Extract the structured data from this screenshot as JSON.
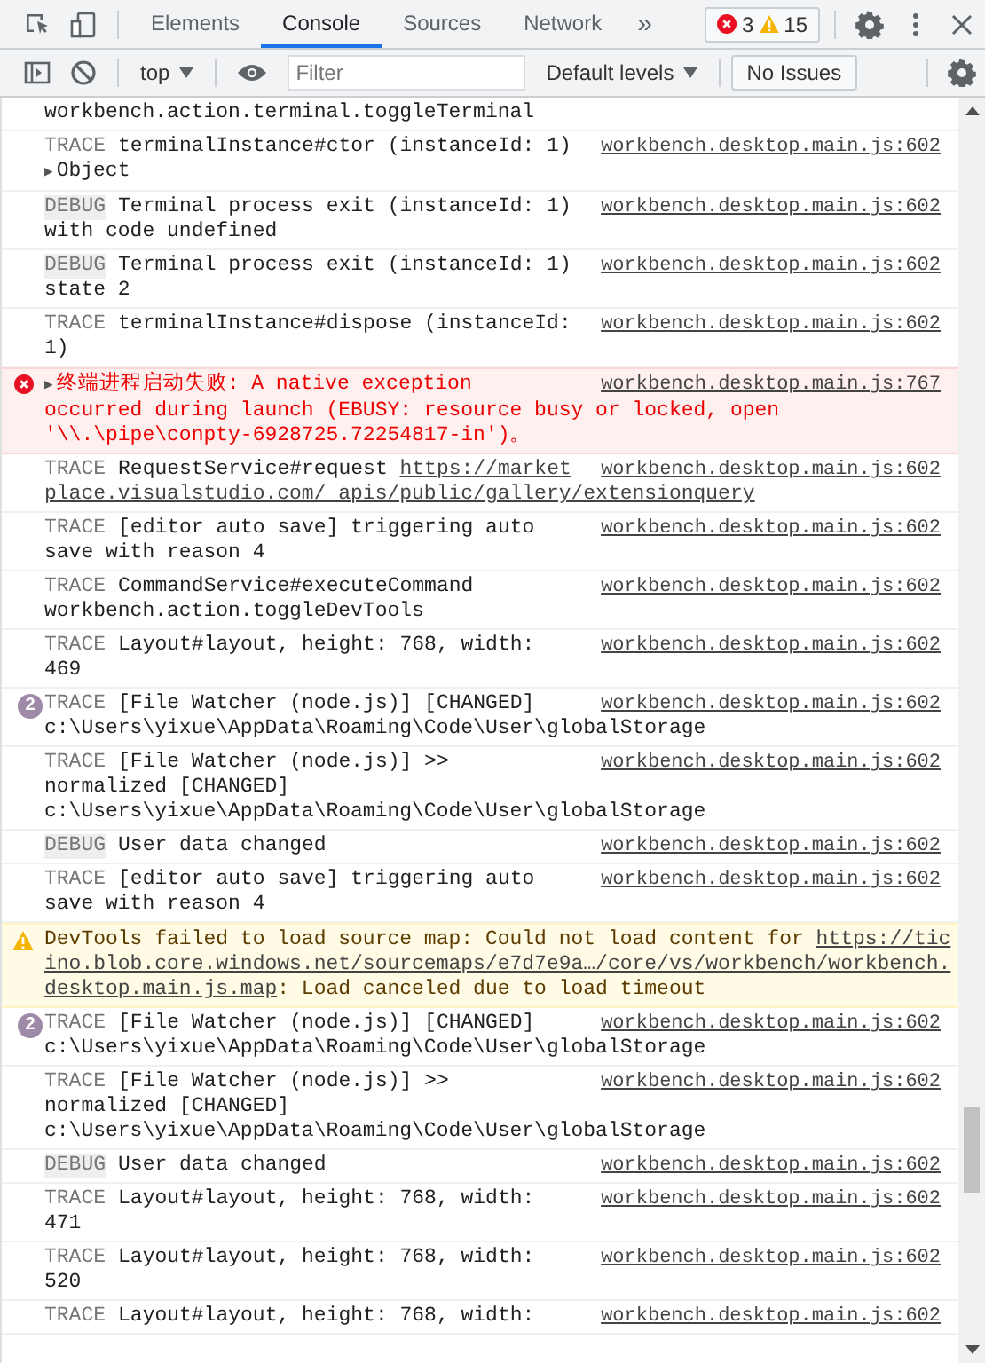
{
  "tabs": [
    {
      "label": "Elements",
      "selected": false
    },
    {
      "label": "Console",
      "selected": true
    },
    {
      "label": "Sources",
      "selected": false
    },
    {
      "label": "Network",
      "selected": false
    }
  ],
  "more_tabs": "»",
  "issue_counter": {
    "errors": "3",
    "warnings": "15"
  },
  "console_toolbar": {
    "context": "top",
    "filter": {
      "placeholder": "Filter"
    },
    "levels": "Default levels",
    "issues": "No Issues"
  },
  "messages": [
    {
      "kind": "log",
      "lines": [
        [
          {
            "text": "workbench.action.terminal.toggleTerminal"
          }
        ]
      ]
    },
    {
      "kind": "log",
      "level": "TRACE",
      "lines": [
        [
          {
            "text": "terminalInstance#ctor (instanceId: 1)"
          }
        ]
      ],
      "object": {
        "arrow": "▶",
        "label": "Object"
      },
      "source": "workbench.desktop.main.js:602"
    },
    {
      "kind": "log",
      "level": "DEBUG",
      "lines": [
        [
          {
            "text": "Terminal process exit (instanceId: 1)"
          }
        ],
        [
          {
            "text": "with code undefined"
          }
        ]
      ],
      "source": "workbench.desktop.main.js:602"
    },
    {
      "kind": "log",
      "level": "DEBUG",
      "lines": [
        [
          {
            "text": "Terminal process exit (instanceId: 1)"
          }
        ],
        [
          {
            "text": "state 2"
          }
        ]
      ],
      "source": "workbench.desktop.main.js:602"
    },
    {
      "kind": "log",
      "level": "TRACE",
      "lines": [
        [
          {
            "text": "terminalInstance#dispose (instanceId:"
          }
        ],
        [
          {
            "text": "1)"
          }
        ]
      ],
      "source": "workbench.desktop.main.js:602"
    },
    {
      "kind": "error",
      "arrow": "▶",
      "lines": [
        [
          {
            "text": "终端进程启动失败: A native exception"
          }
        ],
        [
          {
            "text": "occurred during launch (EBUSY: resource busy or locked, open"
          }
        ],
        [
          {
            "text": "'\\\\.\\pipe\\conpty-6928725.72254817-in')。"
          }
        ]
      ],
      "source": "workbench.desktop.main.js:767"
    },
    {
      "kind": "log",
      "level": "TRACE",
      "lines": [
        [
          {
            "text": "RequestService#request "
          },
          {
            "text": "https://market",
            "link": true
          }
        ],
        [
          {
            "text": "place.visualstudio.com/_apis/public/gallery/extensionquery",
            "link": true
          }
        ]
      ],
      "source": "workbench.desktop.main.js:602"
    },
    {
      "kind": "log",
      "level": "TRACE",
      "lines": [
        [
          {
            "text": "[editor auto save] triggering auto"
          }
        ],
        [
          {
            "text": "save with reason 4"
          }
        ]
      ],
      "source": "workbench.desktop.main.js:602"
    },
    {
      "kind": "log",
      "level": "TRACE",
      "lines": [
        [
          {
            "text": "CommandService#executeCommand"
          }
        ],
        [
          {
            "text": "workbench.action.toggleDevTools"
          }
        ]
      ],
      "source": "workbench.desktop.main.js:602"
    },
    {
      "kind": "log",
      "level": "TRACE",
      "lines": [
        [
          {
            "text": "Layout#layout, height: 768, width:"
          }
        ],
        [
          {
            "text": "469"
          }
        ]
      ],
      "source": "workbench.desktop.main.js:602"
    },
    {
      "kind": "log",
      "count": "2",
      "level": "TRACE",
      "lines": [
        [
          {
            "text": "[File Watcher (node.js)] [CHANGED]"
          }
        ],
        [
          {
            "text": "c:\\Users\\yixue\\AppData\\Roaming\\Code\\User\\globalStorage"
          }
        ]
      ],
      "source": "workbench.desktop.main.js:602"
    },
    {
      "kind": "log",
      "level": "TRACE",
      "lines": [
        [
          {
            "text": "[File Watcher (node.js)] >>"
          }
        ],
        [
          {
            "text": "normalized [CHANGED]"
          }
        ],
        [
          {
            "text": "c:\\Users\\yixue\\AppData\\Roaming\\Code\\User\\globalStorage"
          }
        ]
      ],
      "source": "workbench.desktop.main.js:602"
    },
    {
      "kind": "log",
      "level": "DEBUG",
      "lines": [
        [
          {
            "text": "User data changed"
          }
        ]
      ],
      "source": "workbench.desktop.main.js:602"
    },
    {
      "kind": "log",
      "level": "TRACE",
      "lines": [
        [
          {
            "text": "[editor auto save] triggering auto"
          }
        ],
        [
          {
            "text": "save with reason 4"
          }
        ]
      ],
      "source": "workbench.desktop.main.js:602"
    },
    {
      "kind": "warning",
      "lines": [
        [
          {
            "text": "DevTools failed to load source map: Could not load content for "
          },
          {
            "text": "https://tic",
            "link": true
          }
        ],
        [
          {
            "text": "ino.blob.core.windows.net/sourcemaps/e7d7e9a…/core/vs/workbench/workbench.",
            "link": true
          }
        ],
        [
          {
            "text": "desktop.main.js.map",
            "link": true
          },
          {
            "text": ": Load canceled due to load timeout"
          }
        ]
      ]
    },
    {
      "kind": "log",
      "count": "2",
      "level": "TRACE",
      "lines": [
        [
          {
            "text": "[File Watcher (node.js)] [CHANGED]"
          }
        ],
        [
          {
            "text": "c:\\Users\\yixue\\AppData\\Roaming\\Code\\User\\globalStorage"
          }
        ]
      ],
      "source": "workbench.desktop.main.js:602"
    },
    {
      "kind": "log",
      "level": "TRACE",
      "lines": [
        [
          {
            "text": "[File Watcher (node.js)] >>"
          }
        ],
        [
          {
            "text": "normalized [CHANGED]"
          }
        ],
        [
          {
            "text": "c:\\Users\\yixue\\AppData\\Roaming\\Code\\User\\globalStorage"
          }
        ]
      ],
      "source": "workbench.desktop.main.js:602"
    },
    {
      "kind": "log",
      "level": "DEBUG",
      "lines": [
        [
          {
            "text": "User data changed"
          }
        ]
      ],
      "source": "workbench.desktop.main.js:602"
    },
    {
      "kind": "log",
      "level": "TRACE",
      "lines": [
        [
          {
            "text": "Layout#layout, height: 768, width:"
          }
        ],
        [
          {
            "text": "471"
          }
        ]
      ],
      "source": "workbench.desktop.main.js:602"
    },
    {
      "kind": "log",
      "level": "TRACE",
      "lines": [
        [
          {
            "text": "Layout#layout, height: 768, width:"
          }
        ],
        [
          {
            "text": "520"
          }
        ]
      ],
      "source": "workbench.desktop.main.js:602"
    },
    {
      "kind": "log",
      "level": "TRACE",
      "lines": [
        [
          {
            "text": "Layout#layout, height: 768, width:"
          }
        ]
      ],
      "source": "workbench.desktop.main.js:602"
    }
  ]
}
